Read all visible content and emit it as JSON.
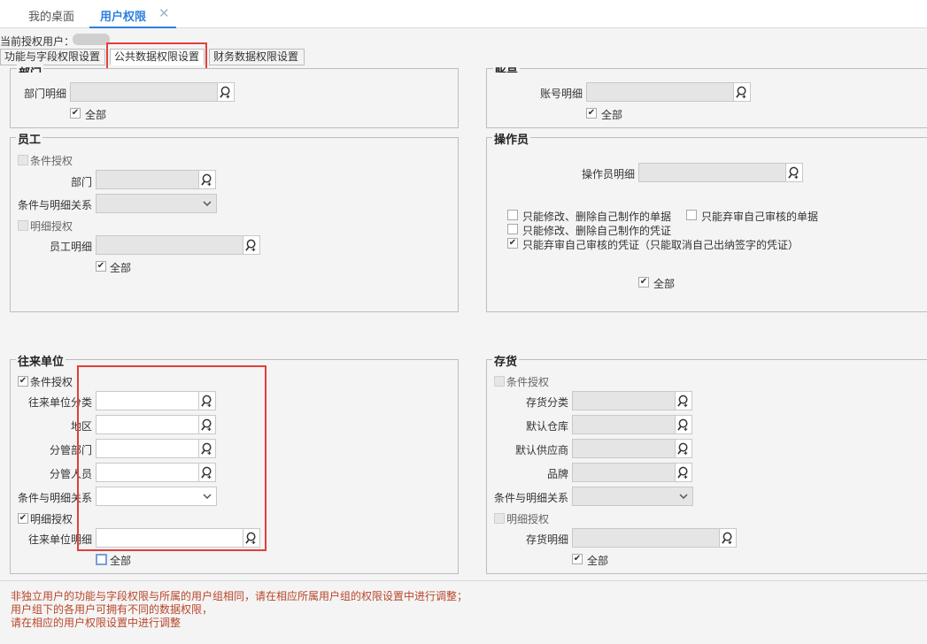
{
  "tabs": {
    "home": "我的桌面",
    "active": "用户权限",
    "close": "✕"
  },
  "current_user_label": "当前授权用户：",
  "subtabs": [
    "功能与字段权限设置",
    "公共数据权限设置",
    "财务数据权限设置"
  ],
  "icons": {
    "lookup": "magnifier-plus-icon",
    "dropdown": "chevron-down-icon",
    "check": "✔"
  },
  "dept": {
    "title": "部门",
    "detail_label": "部门明细",
    "all_label": "全部",
    "all_checked": true
  },
  "account": {
    "title": "账号",
    "detail_label": "账号明细",
    "all_label": "全部",
    "all_checked": true
  },
  "employee": {
    "title": "员工",
    "cond_label": "条件授权",
    "dept_label": "部门",
    "relation_label": "条件与明细关系",
    "detail_auth_label": "明细授权",
    "detail_label": "员工明细",
    "all_label": "全部",
    "all_checked": true
  },
  "operator": {
    "title": "操作员",
    "detail_label": "操作员明细",
    "opt1": "只能修改、删除自己制作的单据",
    "opt2": "只能弃审自己审核的单据",
    "opt3": "只能修改、删除自己制作的凭证",
    "opt4": "只能弃审自己审核的凭证（只能取消自己出纳签字的凭证）",
    "opt4_checked": true,
    "all_label": "全部",
    "all_checked": true
  },
  "partner": {
    "title": "往来单位",
    "cond_label": "条件授权",
    "cond_checked": true,
    "category_label": "往来单位分类",
    "region_label": "地区",
    "dept_label": "分管部门",
    "person_label": "分管人员",
    "relation_label": "条件与明细关系",
    "detail_auth_label": "明细授权",
    "detail_auth_checked": true,
    "detail_label": "往来单位明细",
    "all_label": "全部",
    "all_checked": false
  },
  "inventory": {
    "title": "存货",
    "cond_label": "条件授权",
    "category_label": "存货分类",
    "warehouse_label": "默认仓库",
    "supplier_label": "默认供应商",
    "brand_label": "品牌",
    "relation_label": "条件与明细关系",
    "detail_auth_label": "明细授权",
    "detail_label": "存货明细",
    "all_label": "全部",
    "all_checked": true
  },
  "notes": [
    "非独立用户的功能与字段权限与所属的用户组相同，请在相应所属用户组的权限设置中进行调整；",
    "用户组下的各用户可拥有不同的数据权限，",
    "请在相应的用户权限设置中进行调整"
  ],
  "colors": {
    "accent": "#2d7fe0",
    "highlight": "#e0403a",
    "note": "#b8462a"
  }
}
